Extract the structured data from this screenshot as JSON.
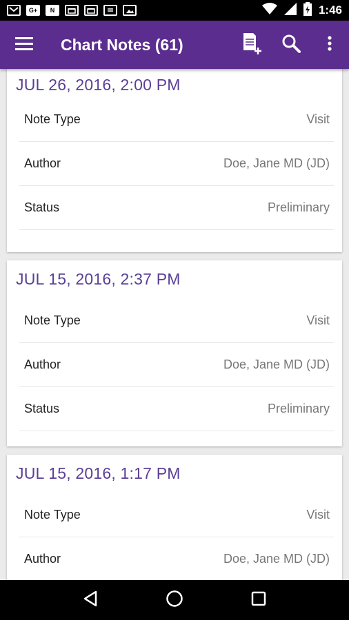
{
  "status_bar": {
    "time": "1:46",
    "icons": [
      "gmail-icon",
      "google-plus-icon",
      "n-icon",
      "calendar-icon",
      "calendar-icon",
      "news-icon",
      "photos-icon",
      "wifi-icon",
      "signal-icon",
      "battery-icon"
    ],
    "gplus_text": "G+",
    "n_text": "N"
  },
  "app_bar": {
    "title": "Chart Notes (61)",
    "icons": [
      "menu-icon",
      "new-note-icon",
      "search-icon",
      "overflow-menu-icon"
    ],
    "color": "#5b2d8e"
  },
  "notes": [
    {
      "date": "JUL 26, 2016, 2:00 PM",
      "rows": [
        {
          "label": "Note Type",
          "value": "Visit"
        },
        {
          "label": "Author",
          "value": "Doe, Jane MD (JD)"
        },
        {
          "label": "Status",
          "value": "Preliminary"
        }
      ]
    },
    {
      "date": "JUL 15, 2016, 2:37 PM",
      "rows": [
        {
          "label": "Note Type",
          "value": "Visit"
        },
        {
          "label": "Author",
          "value": "Doe, Jane MD (JD)"
        },
        {
          "label": "Status",
          "value": "Preliminary"
        }
      ]
    },
    {
      "date": "JUL 15, 2016, 1:17 PM",
      "rows": [
        {
          "label": "Note Type",
          "value": "Visit"
        },
        {
          "label": "Author",
          "value": "Doe, Jane MD (JD)"
        }
      ]
    }
  ],
  "nav_bar": {
    "icons": [
      "back-icon",
      "home-icon",
      "recents-icon"
    ]
  },
  "colors": {
    "accent": "#5b2d8e",
    "date_text": "#5b3f96",
    "value_text": "#777777"
  }
}
